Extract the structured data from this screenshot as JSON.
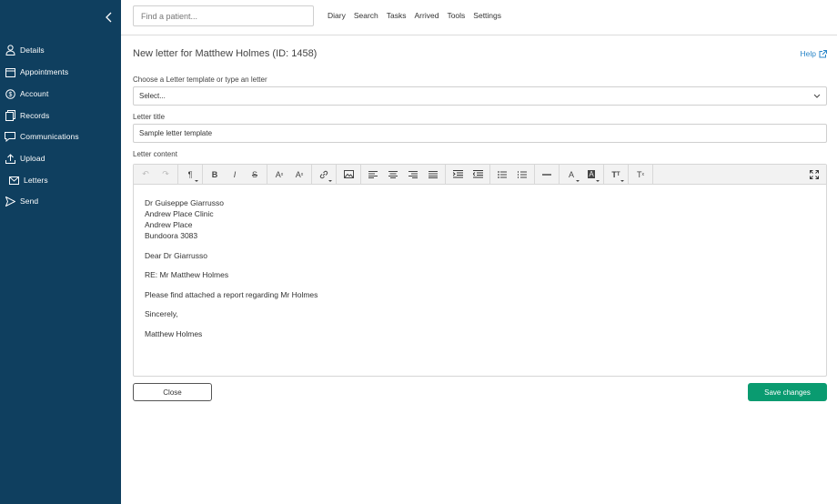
{
  "sidebar": {
    "items": [
      {
        "label": "Details",
        "icon": "person-icon"
      },
      {
        "label": "Appointments",
        "icon": "calendar-icon"
      },
      {
        "label": "Account",
        "icon": "dollar-icon"
      },
      {
        "label": "Records",
        "icon": "records-icon"
      },
      {
        "label": "Communications",
        "icon": "chat-icon"
      },
      {
        "label": "Upload",
        "icon": "upload-icon"
      },
      {
        "label": "Letters",
        "icon": "envelope-icon"
      },
      {
        "label": "Send",
        "icon": "send-icon"
      }
    ]
  },
  "topbar": {
    "search_placeholder": "Find a patient...",
    "nav": [
      "Diary",
      "Search",
      "Tasks",
      "Arrived",
      "Tools",
      "Settings"
    ]
  },
  "main": {
    "title": "New letter for Matthew Holmes (ID: 1458)",
    "help": "Help",
    "template_label": "Choose a Letter template or type an letter",
    "template_value": "Select...",
    "title_label": "Letter title",
    "title_value": "Sample letter template",
    "content_label": "Letter content",
    "content": {
      "address": [
        "Dr Guiseppe Giarrusso",
        "Andrew Place Clinic",
        "Andrew Place",
        "Bundoora 3083"
      ],
      "salutation": "Dear Dr Giarrusso",
      "re": "RE: Mr Matthew Holmes",
      "body": "Please find attached a report regarding Mr Holmes",
      "closing": "Sincerely,",
      "signature": "Matthew Holmes"
    },
    "close_label": "Close",
    "save_label": "Save changes"
  },
  "colors": {
    "sidebar_bg": "#0f3f5f",
    "save_button": "#0a9b70",
    "help_link": "#2a86c8"
  }
}
